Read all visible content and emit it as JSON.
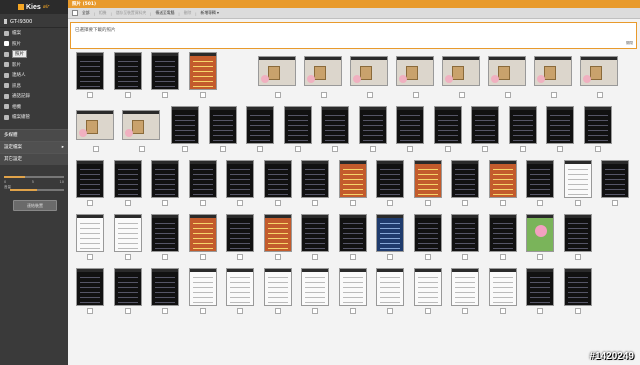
{
  "app": {
    "logo_text": "Kies",
    "logo_sub": "air"
  },
  "sidebar": {
    "device": "GT-I9300",
    "items": [
      {
        "label": "檔案",
        "icon": "file-icon"
      },
      {
        "label": "照片",
        "icon": "photo-icon",
        "tooltip": "照片"
      },
      {
        "label": "音樂",
        "icon": "music-icon"
      },
      {
        "label": "影片",
        "icon": "video-icon"
      },
      {
        "label": "連絡人",
        "icon": "contacts-icon"
      },
      {
        "label": "訊息",
        "icon": "message-icon"
      },
      {
        "label": "通話記錄",
        "icon": "call-log-icon"
      },
      {
        "label": "相機",
        "icon": "camera-icon"
      },
      {
        "label": "檔案總管",
        "icon": "folder-icon"
      }
    ],
    "sections": [
      "多媒體",
      "設定檔案",
      "其它設定"
    ],
    "slider_labels": [
      "0",
      "5",
      "10"
    ],
    "slider2_label": "音量",
    "slider_value": 0.35,
    "slider2_value": 0.55,
    "button_label": "連結裝置"
  },
  "main": {
    "title": "照片 (501)",
    "toolbar": [
      "全部",
      "相機",
      "儲存至裝置資料夾",
      "傳送至電腦",
      "刪除",
      "新增專輯 ▾"
    ],
    "info_message": "已選擇要下載的照片",
    "close_label": "關閉"
  },
  "watermark": "#1420249"
}
